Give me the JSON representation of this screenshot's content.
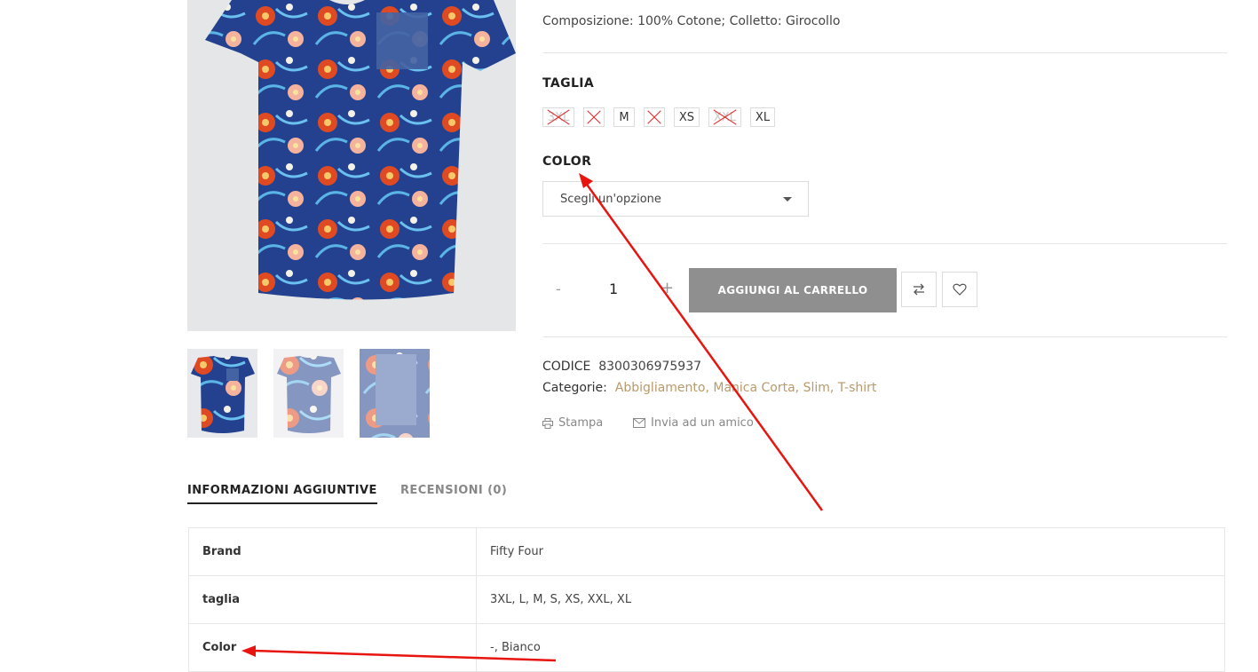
{
  "product": {
    "description": "Composizione: 100% Cotone; Colletto: Girocollo",
    "taglia_label": "TAGLIA",
    "sizes": [
      {
        "label": "3XL",
        "available": false
      },
      {
        "label": "L",
        "available": false
      },
      {
        "label": "M",
        "available": true
      },
      {
        "label": "S",
        "available": false
      },
      {
        "label": "XS",
        "available": true
      },
      {
        "label": "XXL",
        "available": false
      },
      {
        "label": "XL",
        "available": true
      }
    ],
    "color_label": "COLOR",
    "color_select_placeholder": "Scegli un'opzione",
    "quantity": {
      "minus": "-",
      "value": "1",
      "plus": "+"
    },
    "add_to_cart": "AGGIUNGI AL CARRELLO",
    "codice_label": "CODICE",
    "codice_value": "8300306975937",
    "categorie_label": "Categorie:",
    "categorie_value": "Abbigliamento, Manica Corta, Slim, T-shirt",
    "print_label": "Stampa",
    "email_label": "Invia ad un amico"
  },
  "tabs": [
    {
      "label": "INFORMAZIONI AGGIUNTIVE",
      "active": true
    },
    {
      "label": "RECENSIONI (0)",
      "active": false
    }
  ],
  "info_table": [
    {
      "key": "Brand",
      "value": "Fifty Four"
    },
    {
      "key": "taglia",
      "value": "3XL, L, M, S, XS, XXL, XL"
    },
    {
      "key": "Color",
      "value": "-, Bianco"
    }
  ],
  "icons": {
    "compare": "compare-arrows-icon",
    "wishlist": "heart-icon",
    "print": "printer-icon",
    "email": "envelope-icon",
    "select_caret": "caret-down-icon"
  },
  "colors": {
    "accent_link": "#b99a6b",
    "button_bg": "#8f8f8f",
    "annotation_arrow": "#e8140f",
    "unavailable_cross": "#e03030"
  }
}
